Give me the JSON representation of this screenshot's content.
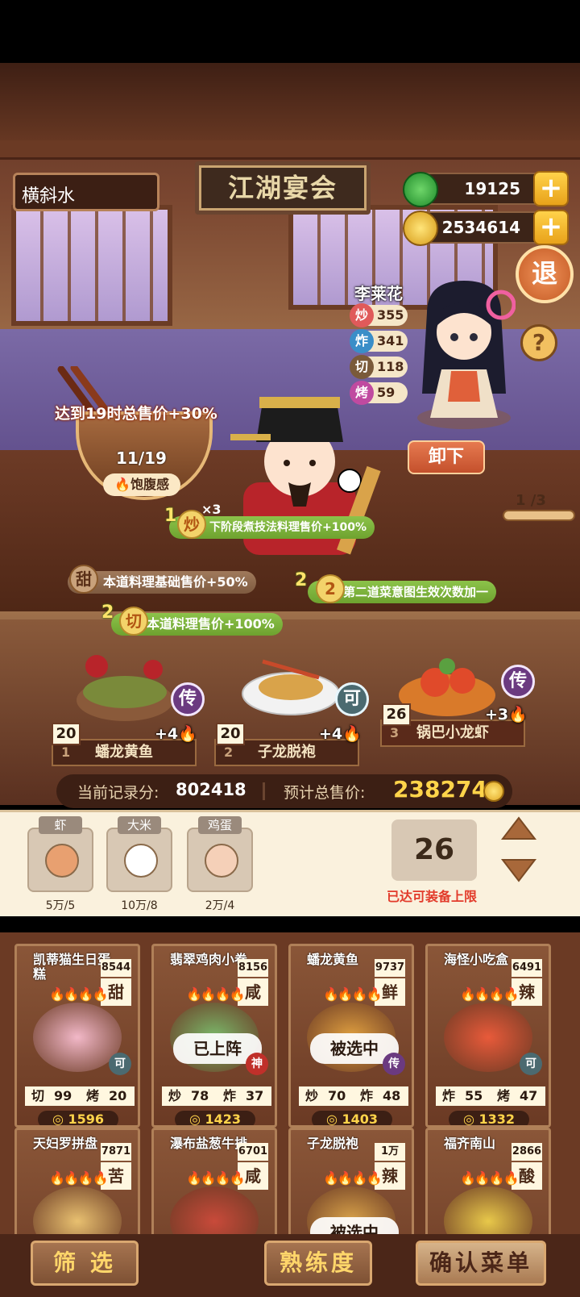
{
  "header": {
    "location": "横斜水",
    "sign": "江湖宴会",
    "jade": "19125",
    "coins": "2534614",
    "exit_label": "退",
    "help_label": "?"
  },
  "chef": {
    "name": "李莱花",
    "stats": [
      {
        "skill": "炒",
        "value": "355",
        "color": "#e05a5a"
      },
      {
        "skill": "炸",
        "value": "341",
        "color": "#3a8ec8"
      },
      {
        "skill": "切",
        "value": "118",
        "color": "#7a5a3a"
      },
      {
        "skill": "烤",
        "value": "59",
        "color": "#c04aa0"
      }
    ],
    "unload_label": "卸下",
    "page": "1 /3"
  },
  "goal": {
    "text": "达到19时总售价+30%",
    "progress": "11/19",
    "progress_ratio": 0.579,
    "satiety_label": "饱腹感"
  },
  "skills": [
    {
      "num": "1",
      "tag": "炒",
      "mult": "×3",
      "text": "下阶段煮技法料理售价+100%"
    },
    {
      "num": "",
      "tag": "甜",
      "mult": "",
      "text": "本道料理基础售价+50%"
    },
    {
      "num": "2",
      "tag": "2",
      "mult": "",
      "text": "第二道菜意图生效次数加一"
    },
    {
      "num": "2",
      "tag": "切",
      "mult": "",
      "text": "本道料理售价+100%"
    }
  ],
  "table_dishes": [
    {
      "index": "1",
      "name": "蟠龙黄鱼",
      "count": "20",
      "badge": "传",
      "bonus": "+4"
    },
    {
      "index": "2",
      "name": "子龙脱袍",
      "count": "20",
      "badge": "可",
      "bonus": "+4"
    },
    {
      "index": "3",
      "name": "锅巴小龙虾",
      "count": "26",
      "badge": "传",
      "bonus": "+3"
    }
  ],
  "score": {
    "record_label": "当前记录分:",
    "record_value": "802418",
    "total_label": "预计总售价:",
    "total_value": "238274"
  },
  "ingredients": [
    {
      "name": "虾",
      "qty": "5万/5"
    },
    {
      "name": "大米",
      "qty": "10万/8"
    },
    {
      "name": "鸡蛋",
      "qty": "2万/4"
    }
  ],
  "equip": {
    "count": "26",
    "limit_text": "已达可装备上限"
  },
  "cards": [
    {
      "title": "凯蒂猫生日蛋糕",
      "price": "8544",
      "flavor": "甜",
      "state": "",
      "corner": "可",
      "corner_color": "#4b6a70",
      "s1": "切",
      "v1": "99",
      "s2": "烤",
      "v2": "20",
      "coin": "1596"
    },
    {
      "title": "翡翠鸡肉小卷",
      "price": "8156",
      "flavor": "咸",
      "state": "已上阵",
      "corner": "神",
      "corner_color": "#c0302a",
      "s1": "炒",
      "v1": "78",
      "s2": "炸",
      "v2": "37",
      "coin": "1423"
    },
    {
      "title": "蟠龙黄鱼",
      "price": "9737",
      "flavor": "鲜",
      "state": "被选中",
      "corner": "传",
      "corner_color": "#6b3a80",
      "s1": "炒",
      "v1": "70",
      "s2": "炸",
      "v2": "48",
      "coin": "1403"
    },
    {
      "title": "海怪小吃盒",
      "price": "6491",
      "flavor": "辣",
      "state": "",
      "corner": "可",
      "corner_color": "#4b6a70",
      "s1": "炸",
      "v1": "55",
      "s2": "烤",
      "v2": "47",
      "coin": "1332"
    },
    {
      "title": "天妇罗拼盘",
      "price": "7871",
      "flavor": "苦",
      "state": "",
      "corner": "",
      "corner_color": "#4b6a70"
    },
    {
      "title": "瀑布盐葱牛排",
      "price": "6701",
      "flavor": "咸",
      "state": "",
      "corner": "",
      "corner_color": "#6b3a80"
    },
    {
      "title": "子龙脱袍",
      "price": "1万",
      "flavor": "辣",
      "state": "被选中",
      "corner": "",
      "corner_color": "#4b6a70"
    },
    {
      "title": "福齐南山",
      "price": "2866",
      "flavor": "酸",
      "state": "",
      "corner": "",
      "corner_color": "#c0302a"
    }
  ],
  "buttons": {
    "filter": "筛 选",
    "proficiency": "熟练度",
    "confirm": "确认菜单"
  }
}
